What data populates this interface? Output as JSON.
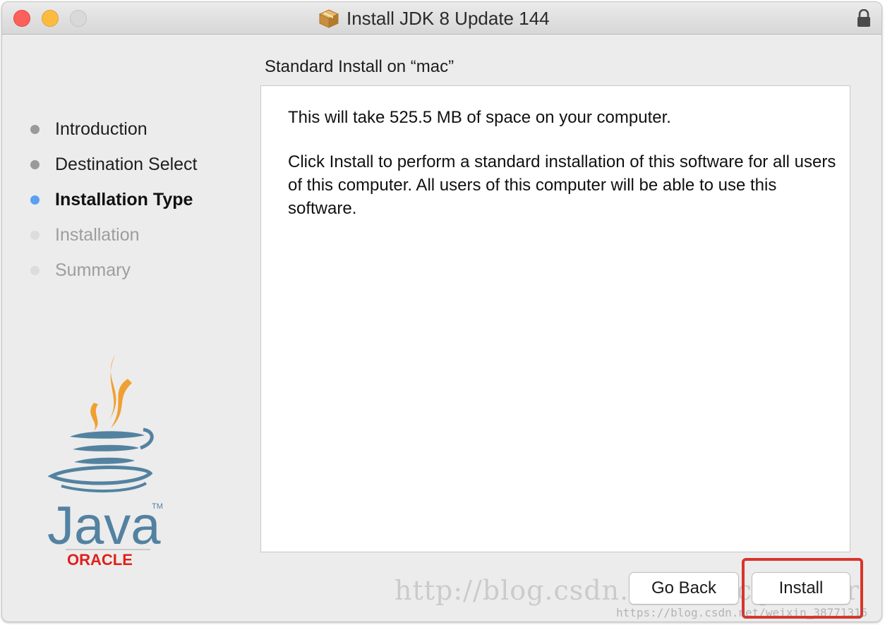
{
  "window": {
    "title": "Install JDK 8 Update 144"
  },
  "sidebar": {
    "steps": [
      {
        "label": "Introduction",
        "state": "done"
      },
      {
        "label": "Destination Select",
        "state": "done"
      },
      {
        "label": "Installation Type",
        "state": "active"
      },
      {
        "label": "Installation",
        "state": "pending"
      },
      {
        "label": "Summary",
        "state": "pending"
      }
    ],
    "logo": {
      "name": "java-logo",
      "text": "Java",
      "subtext": "ORACLE",
      "trademark": "TM"
    }
  },
  "main": {
    "subtitle": "Standard Install on “mac”",
    "paragraph1": "This will take 525.5 MB of space on your computer.",
    "paragraph2": "Click Install to perform a standard installation of this software for all users of this computer. All users of this computer will be able to use this software."
  },
  "buttons": {
    "go_back": "Go Back",
    "install": "Install"
  },
  "watermark": {
    "text": "http://blog.csdn.net/melcijonsior",
    "small": "https://blog.csdn.net/weixin_38771315"
  },
  "colors": {
    "close": "#fc605b",
    "minimize": "#fdbc40",
    "active_dot": "#5aa0f0",
    "highlight": "#d9342b",
    "java_orange": "#f0a030",
    "java_blue": "#5382a1",
    "oracle_red": "#e0201b"
  },
  "icons": [
    "package-icon",
    "lock-icon"
  ]
}
